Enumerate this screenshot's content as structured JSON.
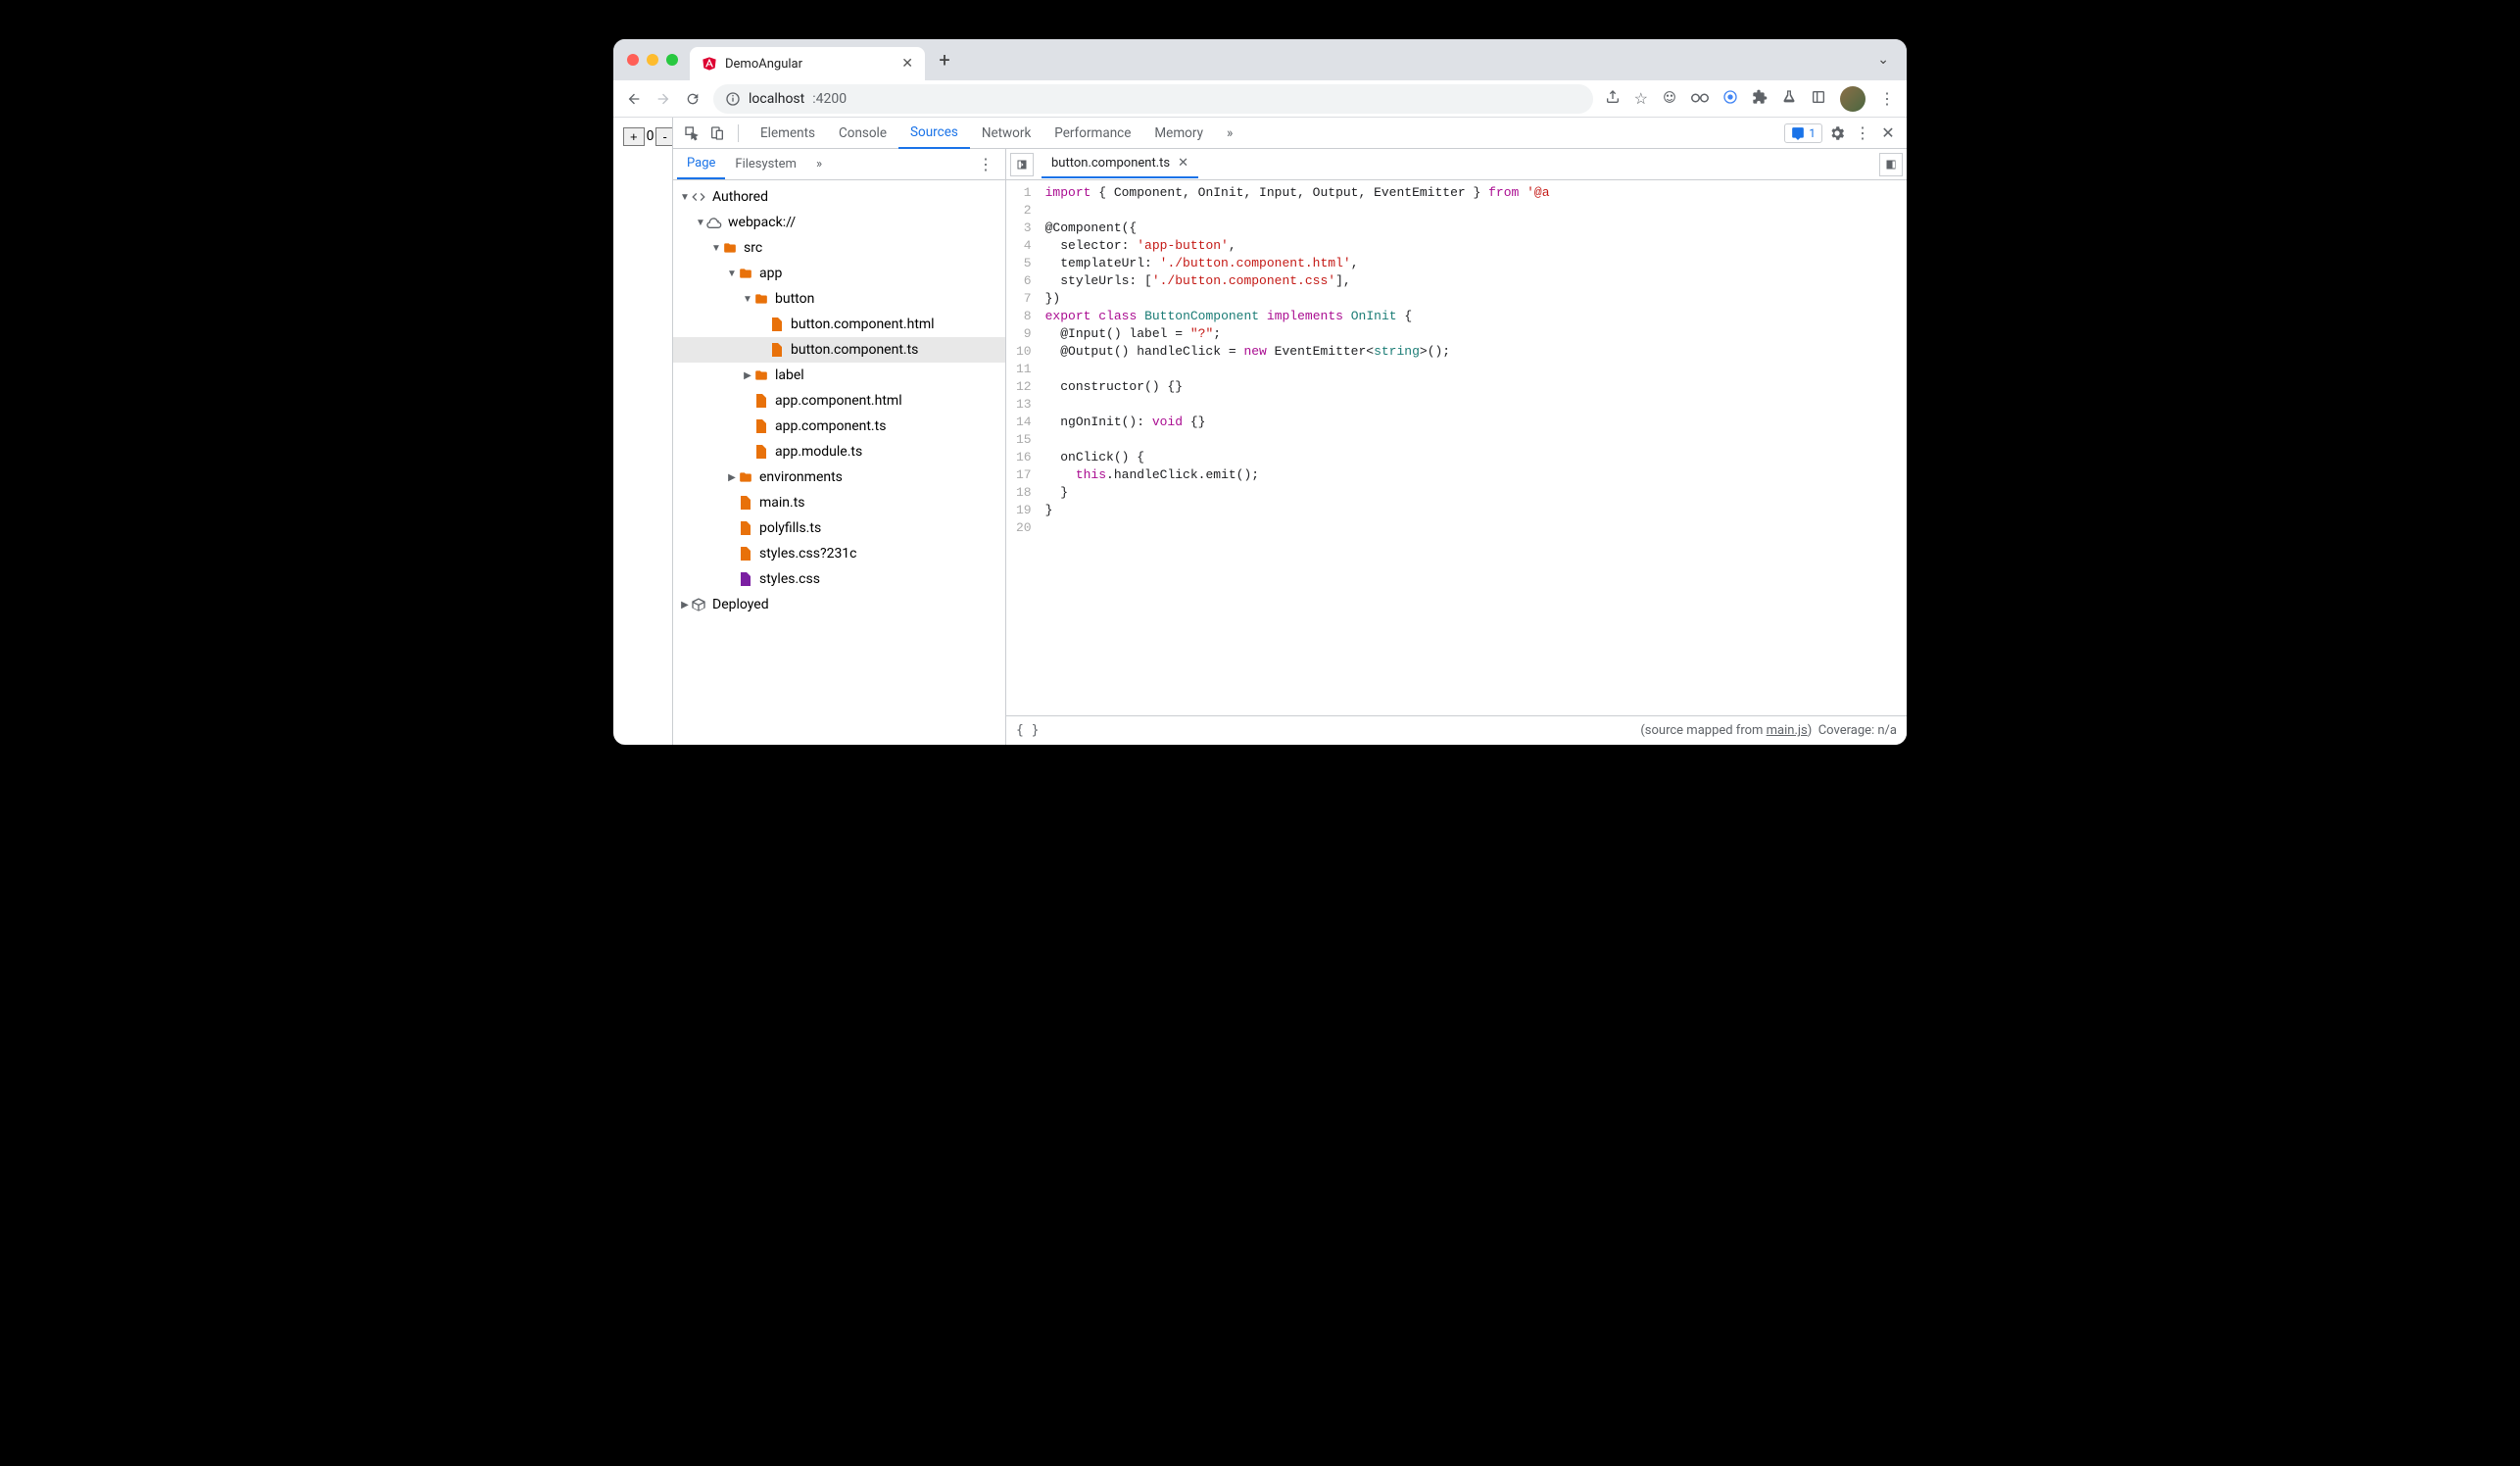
{
  "browser": {
    "tab_title": "DemoAngular",
    "url_host": "localhost",
    "url_port": ":4200"
  },
  "app": {
    "btn_plus": "+",
    "counter": "0",
    "btn_minus": "-"
  },
  "devtools": {
    "tabs": [
      "Elements",
      "Console",
      "Sources",
      "Network",
      "Performance",
      "Memory"
    ],
    "active_tab": "Sources",
    "issue_count": "1",
    "nav": {
      "tabs": [
        "Page",
        "Filesystem"
      ],
      "active": "Page",
      "tree": {
        "authored": "Authored",
        "webpack": "webpack://",
        "src": "src",
        "app": "app",
        "button": "button",
        "button_html": "button.component.html",
        "button_ts": "button.component.ts",
        "label": "label",
        "app_html": "app.component.html",
        "app_ts": "app.component.ts",
        "app_module": "app.module.ts",
        "environments": "environments",
        "main_ts": "main.ts",
        "polyfills_ts": "polyfills.ts",
        "styles_q": "styles.css?231c",
        "styles": "styles.css",
        "deployed": "Deployed"
      }
    },
    "editor": {
      "filename": "button.component.ts",
      "lines": 20
    },
    "footer": {
      "mapped_prefix": "(source mapped from ",
      "mapped_link": "main.js",
      "mapped_suffix": ")",
      "coverage": "Coverage: n/a"
    }
  }
}
